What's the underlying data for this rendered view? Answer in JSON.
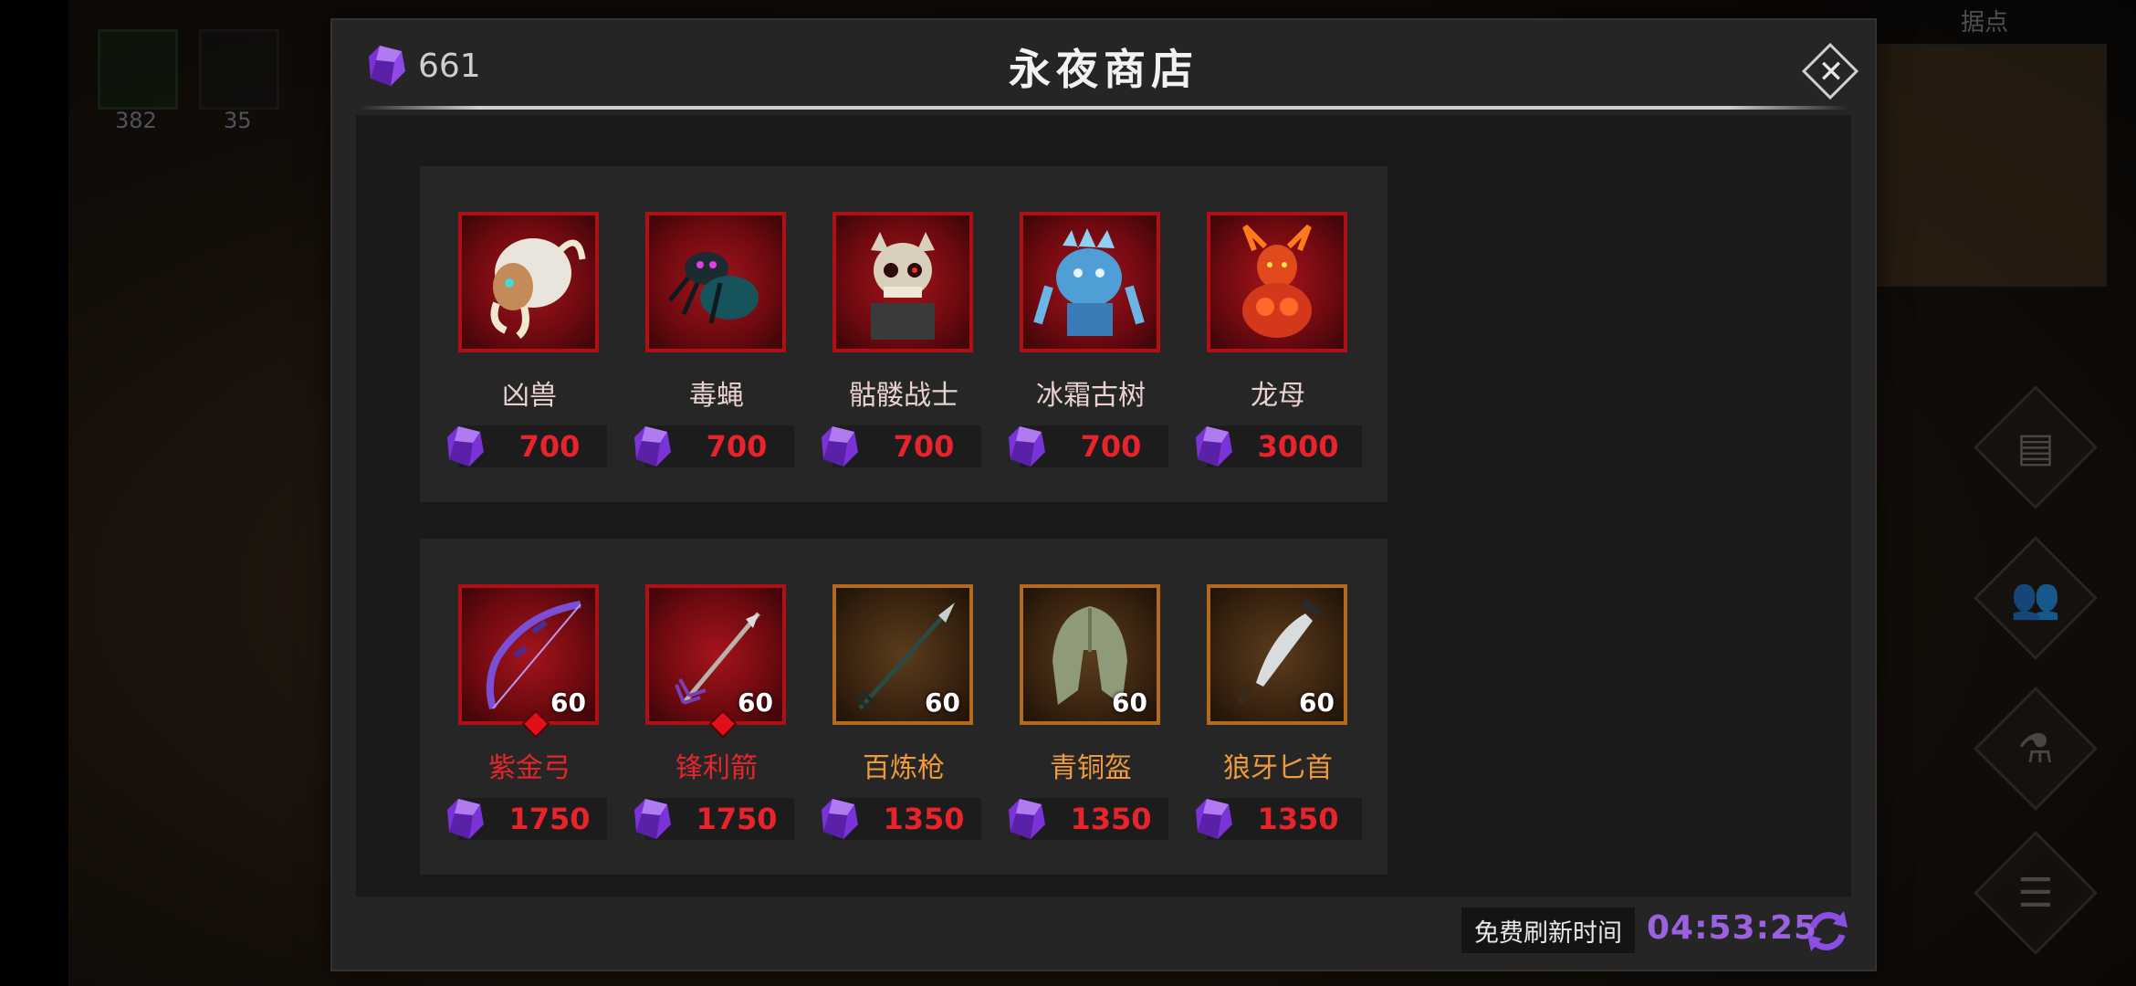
{
  "background": {
    "top_items": [
      {
        "icon": "feather-icon",
        "count": "382"
      },
      {
        "icon": "feather-icon",
        "count": "35"
      }
    ],
    "minimap_title": "据点",
    "side_buttons": [
      "scroll-icon",
      "friends-icon",
      "potion-icon",
      "list-icon"
    ]
  },
  "shop": {
    "currency_count": "661",
    "title": "永夜商店",
    "refresh_label": "免费刷新时间",
    "refresh_timer": "04:53:25"
  },
  "items": [
    {
      "name": "凶兽",
      "price": "700",
      "level": "",
      "frame": "red",
      "name_color": "light",
      "icon": "beast-icon"
    },
    {
      "name": "毒蝇",
      "price": "700",
      "level": "",
      "frame": "red",
      "name_color": "light",
      "icon": "poison-fly-icon"
    },
    {
      "name": "骷髅战士",
      "price": "700",
      "level": "",
      "frame": "red",
      "name_color": "light",
      "icon": "skeleton-warrior-icon"
    },
    {
      "name": "冰霜古树",
      "price": "700",
      "level": "",
      "frame": "red",
      "name_color": "light",
      "icon": "frost-treant-icon"
    },
    {
      "name": "龙母",
      "price": "3000",
      "level": "",
      "frame": "red",
      "name_color": "light",
      "icon": "dragon-mother-icon"
    },
    {
      "name": "紫金弓",
      "price": "1750",
      "level": "60",
      "frame": "red",
      "name_color": "red",
      "icon": "bow-icon"
    },
    {
      "name": "锋利箭",
      "price": "1750",
      "level": "60",
      "frame": "red",
      "name_color": "red",
      "icon": "arrow-icon"
    },
    {
      "name": "百炼枪",
      "price": "1350",
      "level": "60",
      "frame": "bronze",
      "name_color": "orange",
      "icon": "spear-icon"
    },
    {
      "name": "青铜盔",
      "price": "1350",
      "level": "60",
      "frame": "bronze",
      "name_color": "orange",
      "icon": "helmet-icon"
    },
    {
      "name": "狼牙匕首",
      "price": "1350",
      "level": "60",
      "frame": "bronze",
      "name_color": "orange",
      "icon": "dagger-icon"
    }
  ],
  "colors": {
    "price": "#e8232b",
    "timer": "#9a62df",
    "gem": "#8a3ee6",
    "red_frame": "#b01015",
    "bronze_frame": "#b36a1c"
  }
}
